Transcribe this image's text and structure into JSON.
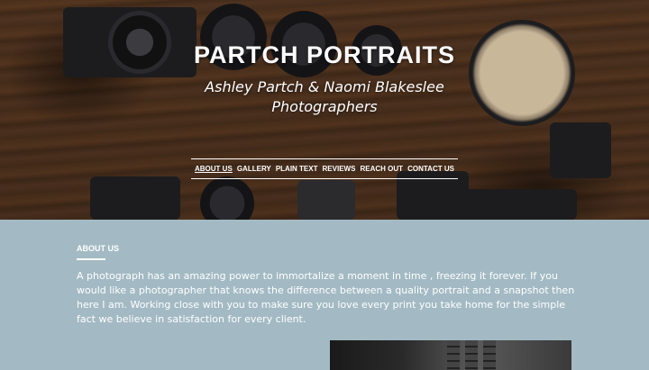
{
  "hero": {
    "title": "PARTCH PORTRAITS",
    "subtitle_line1": "Ashley Partch & Naomi Blakeslee",
    "subtitle_line2": "Photographers"
  },
  "nav": {
    "items": [
      {
        "label": "ABOUT US",
        "active": true
      },
      {
        "label": "GALLERY",
        "active": false
      },
      {
        "label": "PLAIN TEXT",
        "active": false
      },
      {
        "label": "REVIEWS",
        "active": false
      },
      {
        "label": "REACH OUT",
        "active": false
      },
      {
        "label": "CONTACT US",
        "active": false
      }
    ]
  },
  "about": {
    "heading": "ABOUT US",
    "body": "A photograph has an amazing power to immortalize a moment in time , freezing it forever. If you would like a photographer that knows the difference between a quality portrait and a snapshot then here I am. Working close with you to make sure you love every print you take home for the simple fact we believe in satisfaction for every client."
  },
  "colors": {
    "section_background": "#a3bac4",
    "text": "#ffffff"
  }
}
